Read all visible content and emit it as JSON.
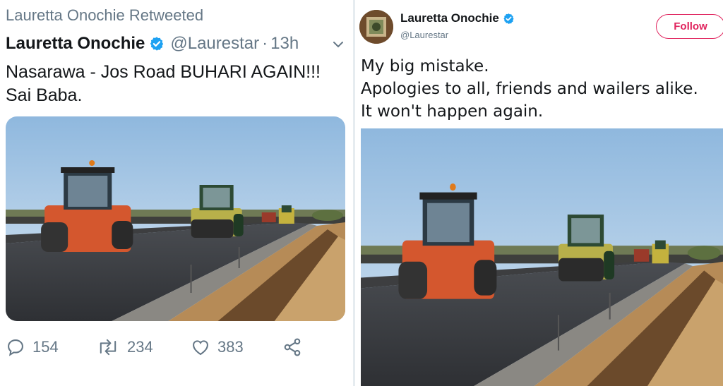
{
  "left_tweet": {
    "retweet_label": "Lauretta Onochie Retweeted",
    "author_name": "Lauretta Onochie",
    "author_handle": "@Laurestar",
    "separator": "·",
    "timestamp": "13h",
    "text_lines": [
      "Nasarawa - Jos Road  BUHARI AGAIN!!!",
      "Sai Baba."
    ],
    "actions": {
      "reply_count": "154",
      "retweet_count": "234",
      "like_count": "383"
    },
    "icons": {
      "verified": "verified-badge-icon",
      "more": "chevron-down-icon",
      "reply": "reply-icon",
      "retweet": "retweet-icon",
      "like": "heart-icon",
      "share": "share-icon"
    }
  },
  "right_tweet": {
    "author_name": "Lauretta Onochie",
    "author_handle": "@Laurestar",
    "follow_label": "Follow",
    "text_lines": [
      "My big mistake.",
      "Apologies to all, friends and wailers alike.",
      "It won't happen again."
    ]
  },
  "colors": {
    "text_primary": "#14171a",
    "text_secondary": "#657786",
    "verified_blue": "#1da1f2",
    "follow_accent": "#e0245e"
  }
}
